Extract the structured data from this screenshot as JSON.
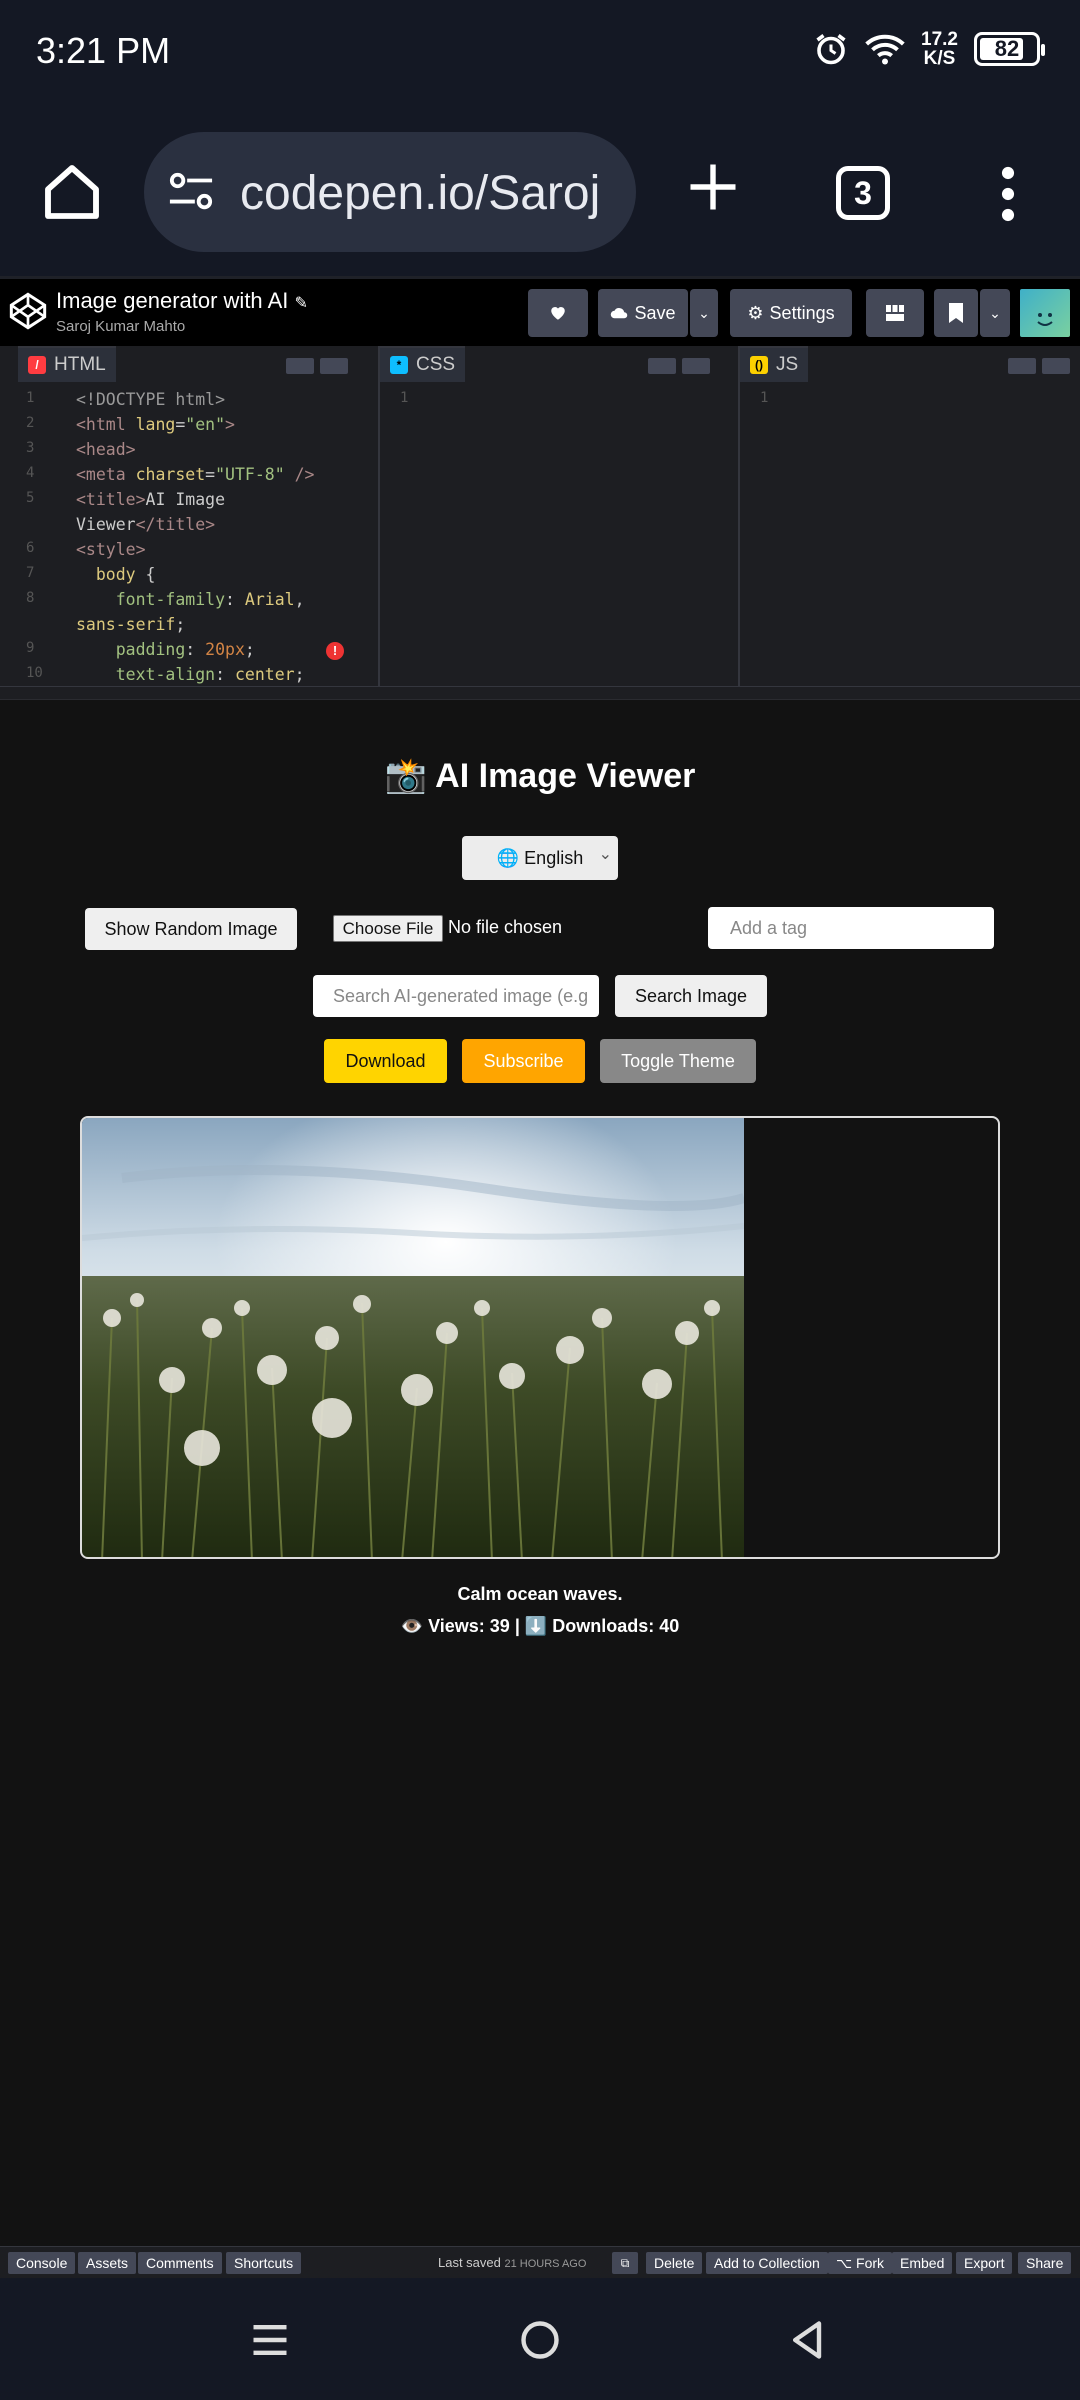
{
  "status_bar": {
    "time": "3:21 PM",
    "net_speed_value": "17.2",
    "net_speed_unit": "K/S",
    "battery": "82",
    "battery_level": 0.82
  },
  "browser": {
    "url": "codepen.io/Saroj",
    "tab_count": "3"
  },
  "codepen": {
    "title": "Image generator with AI",
    "author": "Saroj Kumar Mahto",
    "save_label": "Save",
    "settings_label": "Settings",
    "panels": {
      "html": "HTML",
      "css": "CSS",
      "js": "JS"
    },
    "css_line_number": "1",
    "js_line_number": "1"
  },
  "preview": {
    "title": "📸 AI Image Viewer",
    "language": "🌐 English",
    "show_random_label": "Show Random Image",
    "choose_file_label": "Choose File",
    "no_file_label": "No file chosen",
    "tag_placeholder": "Add a tag",
    "search_placeholder": "Search AI-generated image (e.g",
    "search_label": "Search Image",
    "download_label": "Download",
    "subscribe_label": "Subscribe",
    "toggle_theme_label": "Toggle Theme",
    "caption": "Calm ocean waves.",
    "stats": "👁️ Views: 39 | ⬇️ Downloads: 40"
  },
  "footer": {
    "console": "Console",
    "assets": "Assets",
    "comments": "Comments",
    "shortcuts": "Shortcuts",
    "last_saved": "Last saved",
    "saved_ago": "21 HOURS AGO",
    "delete": "Delete",
    "add_to_collection": "Add to Collection",
    "fork": "⌥ Fork",
    "embed": "Embed",
    "export": "Export",
    "share": "Share"
  },
  "colors": {
    "download": "#ffd400",
    "subscribe": "#ffa500",
    "toggle_theme": "#888888",
    "html_badge": "#ff3c41",
    "css_badge": "#0ebeff",
    "js_badge": "#fcd000"
  }
}
